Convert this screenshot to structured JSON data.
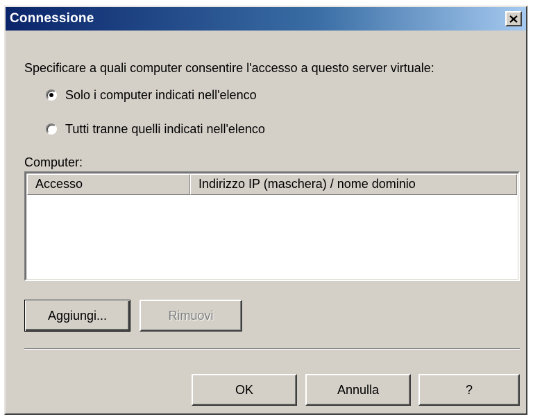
{
  "window": {
    "title": "Connessione",
    "close_icon": "close-icon"
  },
  "prompt": "Specificare a quali computer consentire l'accesso a questo server virtuale:",
  "radio_options": [
    {
      "label": "Solo i computer indicati nell'elenco",
      "selected": true
    },
    {
      "label": "Tutti tranne quelli indicati nell'elenco",
      "selected": false
    }
  ],
  "computer_label": "Computer:",
  "list": {
    "columns": [
      "Accesso",
      "Indirizzo IP (maschera) / nome dominio"
    ],
    "rows": []
  },
  "buttons": {
    "add": "Aggiungi...",
    "remove": "Rimuovi",
    "ok": "OK",
    "cancel": "Annulla",
    "help": "?"
  },
  "colors": {
    "titlebar_start": "#0a246a",
    "titlebar_end": "#a6caf0",
    "face": "#d4d0c8"
  }
}
